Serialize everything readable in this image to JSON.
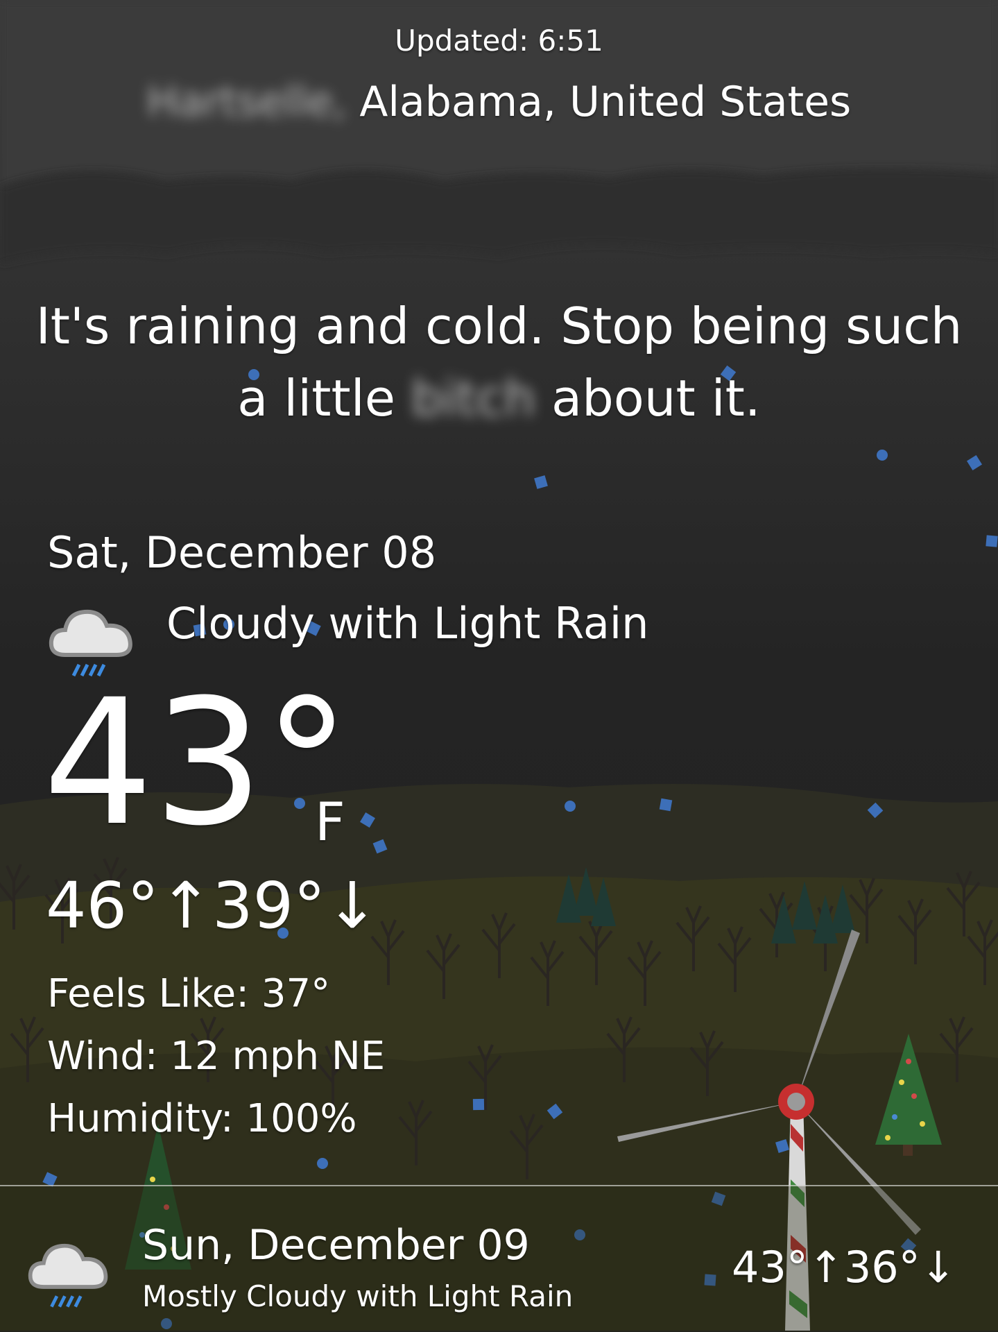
{
  "header": {
    "updated": "Updated: 6:51",
    "location_blurred": "Hartselle,",
    "location": "Alabama, United States"
  },
  "message": {
    "part1": "It's raining and cold. Stop being such a little ",
    "blurred_word": "bitch",
    "part2": " about it."
  },
  "today": {
    "date": "Sat, December 08",
    "condition": "Cloudy with Light Rain",
    "icon": "cloud-rain-icon",
    "temperature": "43°",
    "unit": "F",
    "hi_lo": "46°↑39°↓",
    "feels_like": "Feels Like: 37°",
    "wind": "Wind: 12 mph NE",
    "humidity": "Humidity: 100%"
  },
  "forecast": [
    {
      "date": "Sun, December 09",
      "condition": "Mostly Cloudy with Light Rain",
      "icon": "cloud-rain-icon",
      "hi_lo": "43°↑36°↓"
    }
  ],
  "colors": {
    "sky": "#232323",
    "hills": "#3a3a1f",
    "rain_accent": "#3d6fb8",
    "text": "#ffffff"
  }
}
